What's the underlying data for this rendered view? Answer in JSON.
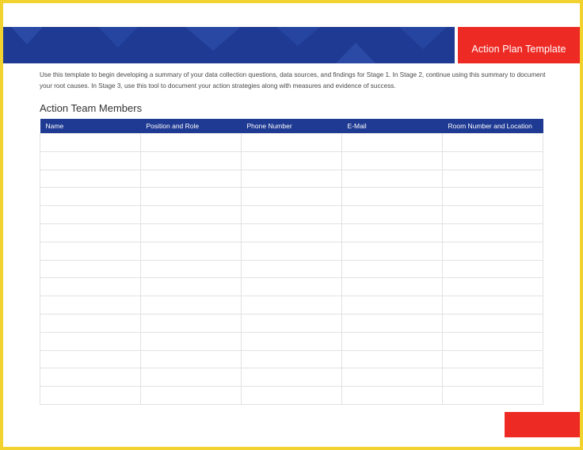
{
  "banner": {
    "title": "Action Plan Template",
    "colors": {
      "blue": "#1f3a93",
      "red": "#ee2a24",
      "frame": "#f2d22e"
    }
  },
  "intro": {
    "text": "Use this template to begin developing a summary of your data collection questions, data sources, and findings for Stage 1. In Stage 2, continue using this summary to document your root causes. In Stage 3, use this tool to document your action strategies along with measures and evidence of success."
  },
  "section": {
    "title": "Action Team Members"
  },
  "table": {
    "columns": [
      "Name",
      "Position and Role",
      "Phone Number",
      "E-Mail",
      "Room Number and Location"
    ],
    "rows": [
      [
        "",
        "",
        "",
        "",
        ""
      ],
      [
        "",
        "",
        "",
        "",
        ""
      ],
      [
        "",
        "",
        "",
        "",
        ""
      ],
      [
        "",
        "",
        "",
        "",
        ""
      ],
      [
        "",
        "",
        "",
        "",
        ""
      ],
      [
        "",
        "",
        "",
        "",
        ""
      ],
      [
        "",
        "",
        "",
        "",
        ""
      ],
      [
        "",
        "",
        "",
        "",
        ""
      ],
      [
        "",
        "",
        "",
        "",
        ""
      ],
      [
        "",
        "",
        "",
        "",
        ""
      ],
      [
        "",
        "",
        "",
        "",
        ""
      ],
      [
        "",
        "",
        "",
        "",
        ""
      ],
      [
        "",
        "",
        "",
        "",
        ""
      ],
      [
        "",
        "",
        "",
        "",
        ""
      ],
      [
        "",
        "",
        "",
        "",
        ""
      ]
    ]
  }
}
